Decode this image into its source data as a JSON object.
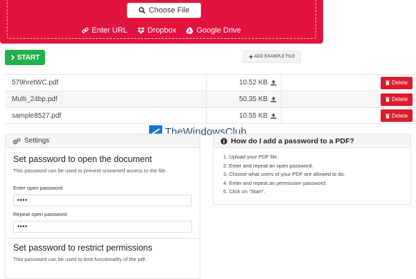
{
  "upload": {
    "choose_label": "Choose File",
    "sources": [
      {
        "icon": "link-icon",
        "label": "Enter URL"
      },
      {
        "icon": "dropbox-icon",
        "label": "Dropbox"
      },
      {
        "icon": "google-drive-icon",
        "label": "Google Drive"
      }
    ]
  },
  "actions": {
    "start_label": "START",
    "example_label": "ADD EXAMPLE FILE"
  },
  "files": [
    {
      "name": "579hretWC.pdf",
      "size": "10.52 KB",
      "delete": "Delete"
    },
    {
      "name": "Multi_24bp.pdf",
      "size": "50.35 KB",
      "delete": "Delete"
    },
    {
      "name": "sample8527.pdf",
      "size": "10.55 KB",
      "delete": "Delete"
    }
  ],
  "watermark": "TheWindowsClub",
  "settings": {
    "title": "Settings",
    "open": {
      "title": "Set password to open the document",
      "desc": "This password can be used to prevent unwanted access to the file.",
      "enter_label": "Enter open password",
      "enter_value": "••••",
      "repeat_label": "Repeat open password",
      "repeat_value": "••••"
    },
    "restrict": {
      "title": "Set password to restrict permissions",
      "desc": "This password can be used to limit functionality of the pdf."
    }
  },
  "howto": {
    "title": "How do I add a password to a PDF?",
    "steps": [
      "1. Upload your PDF file.",
      "2. Enter and repeat an open password.",
      "3. Choose what users of your PDF are allowed to do.",
      "4. Enter and repeat an permission password.",
      "5. Click on \"Start\"."
    ]
  },
  "colors": {
    "dropzone": "#e3133f",
    "start": "#22b14c",
    "delete": "#dc1c2d",
    "watermark_text": "#2f4e6e"
  }
}
